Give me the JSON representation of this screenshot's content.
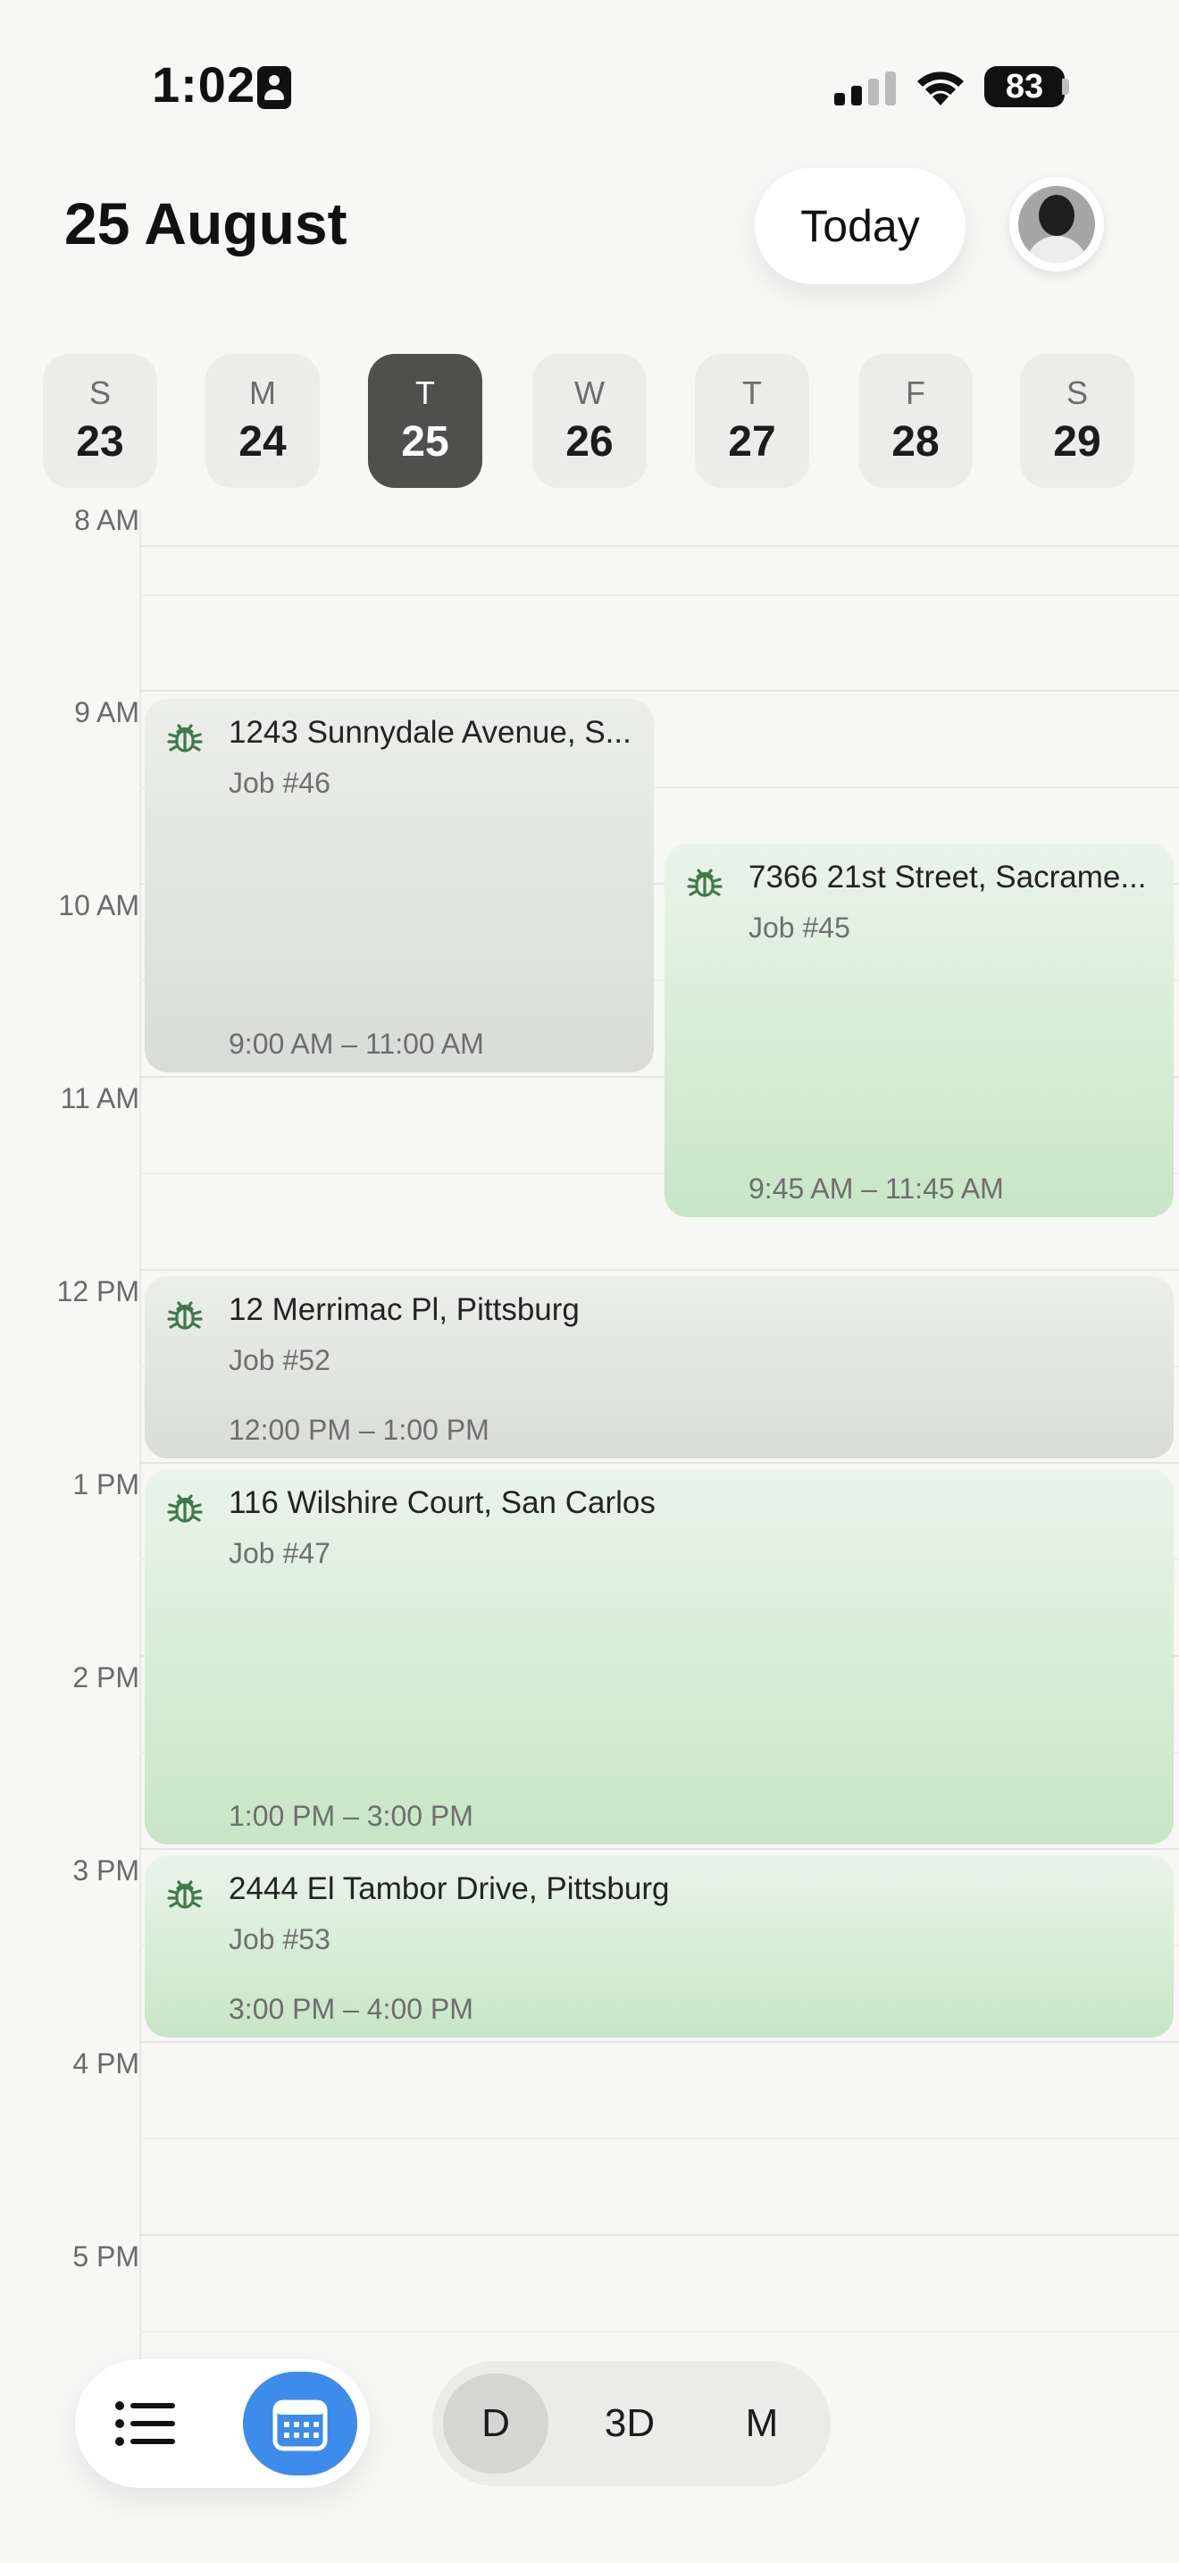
{
  "status_bar": {
    "time": "1:02",
    "battery": "83"
  },
  "header": {
    "title": "25 August",
    "today_label": "Today"
  },
  "week": [
    {
      "letter": "S",
      "num": "23",
      "selected": false
    },
    {
      "letter": "M",
      "num": "24",
      "selected": false
    },
    {
      "letter": "T",
      "num": "25",
      "selected": true
    },
    {
      "letter": "W",
      "num": "26",
      "selected": false
    },
    {
      "letter": "T",
      "num": "27",
      "selected": false
    },
    {
      "letter": "F",
      "num": "28",
      "selected": false
    },
    {
      "letter": "S",
      "num": "29",
      "selected": false
    }
  ],
  "hours": [
    "8 AM",
    "9 AM",
    "10 AM",
    "11 AM",
    "12 PM",
    "1 PM",
    "2 PM",
    "3 PM",
    "4 PM",
    "5 PM"
  ],
  "events": [
    {
      "title": "1243 Sunnydale Avenue, S...",
      "job": "Job #46",
      "time": "9:00 AM – 11:00 AM",
      "color": "grey",
      "icon": "bug-icon"
    },
    {
      "title": "7366 21st Street, Sacrame...",
      "job": "Job #45",
      "time": "9:45 AM – 11:45 AM",
      "color": "green",
      "icon": "bug-icon"
    },
    {
      "title": "12 Merrimac Pl, Pittsburg",
      "job": "Job #52",
      "time": "12:00 PM – 1:00 PM",
      "color": "grey",
      "icon": "bug-icon"
    },
    {
      "title": "116 Wilshire Court, San Carlos",
      "job": "Job #47",
      "time": "1:00 PM – 3:00 PM",
      "color": "green",
      "icon": "bug-icon"
    },
    {
      "title": "2444 El Tambor Drive, Pittsburg",
      "job": "Job #53",
      "time": "3:00 PM – 4:00 PM",
      "color": "green",
      "icon": "bug-icon"
    }
  ],
  "bottom_bar": {
    "view_icons": [
      "list-icon",
      "calendar-icon"
    ],
    "active_view": "calendar",
    "ranges": [
      "D",
      "3D",
      "M"
    ],
    "active_range": "D"
  },
  "colors": {
    "accent": "#3d8bea",
    "selected_day": "#4f4f4d",
    "event_green": "#c7e6c6",
    "event_grey": "#d9dcd8",
    "icon_green": "#3f7a48"
  }
}
